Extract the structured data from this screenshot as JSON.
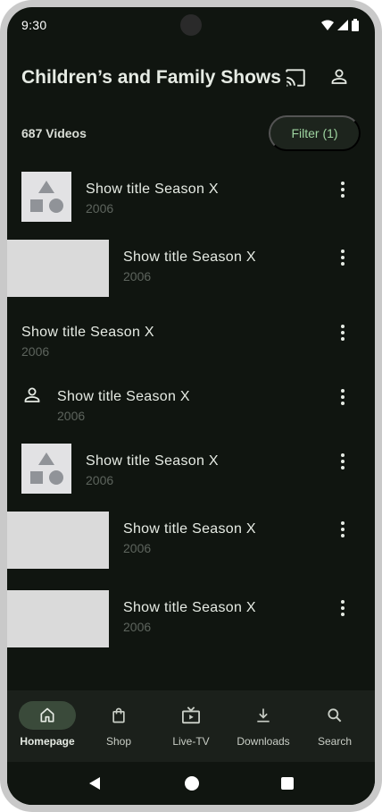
{
  "status_bar": {
    "time": "9:30"
  },
  "header": {
    "title": "Children’s and Family Shows",
    "cast_icon": "cast-icon",
    "account_icon": "account-icon"
  },
  "toolbar": {
    "count": "687 Videos",
    "filter_label": "Filter (1)"
  },
  "list": {
    "items": [
      {
        "title": "Show title Season X",
        "year": "2006",
        "media": "shapes-thumbnail"
      },
      {
        "title": "Show title Season X",
        "year": "2006",
        "media": "wide-thumbnail"
      },
      {
        "title": "Show title Season X",
        "year": "2006",
        "media": "none"
      },
      {
        "title": "Show title Season X",
        "year": "2006",
        "media": "person-icon"
      },
      {
        "title": "Show title Season X",
        "year": "2006",
        "media": "shapes-thumbnail"
      },
      {
        "title": "Show title Season X",
        "year": "2006",
        "media": "wide-thumbnail"
      },
      {
        "title": "Show title Season X",
        "year": "2006",
        "media": "wide-thumbnail"
      }
    ]
  },
  "bottom_nav": {
    "items": [
      {
        "label": "Homepage",
        "icon": "home-icon",
        "active": true
      },
      {
        "label": "Shop",
        "icon": "shopping-bag-icon",
        "active": false
      },
      {
        "label": "Live-TV",
        "icon": "live-tv-icon",
        "active": false
      },
      {
        "label": "Downloads",
        "icon": "download-icon",
        "active": false
      },
      {
        "label": "Search",
        "icon": "search-icon",
        "active": false
      }
    ]
  },
  "colors": {
    "background": "#101510",
    "accent": "#9ed4a0",
    "nav_active_pill": "#3a4a3a"
  }
}
